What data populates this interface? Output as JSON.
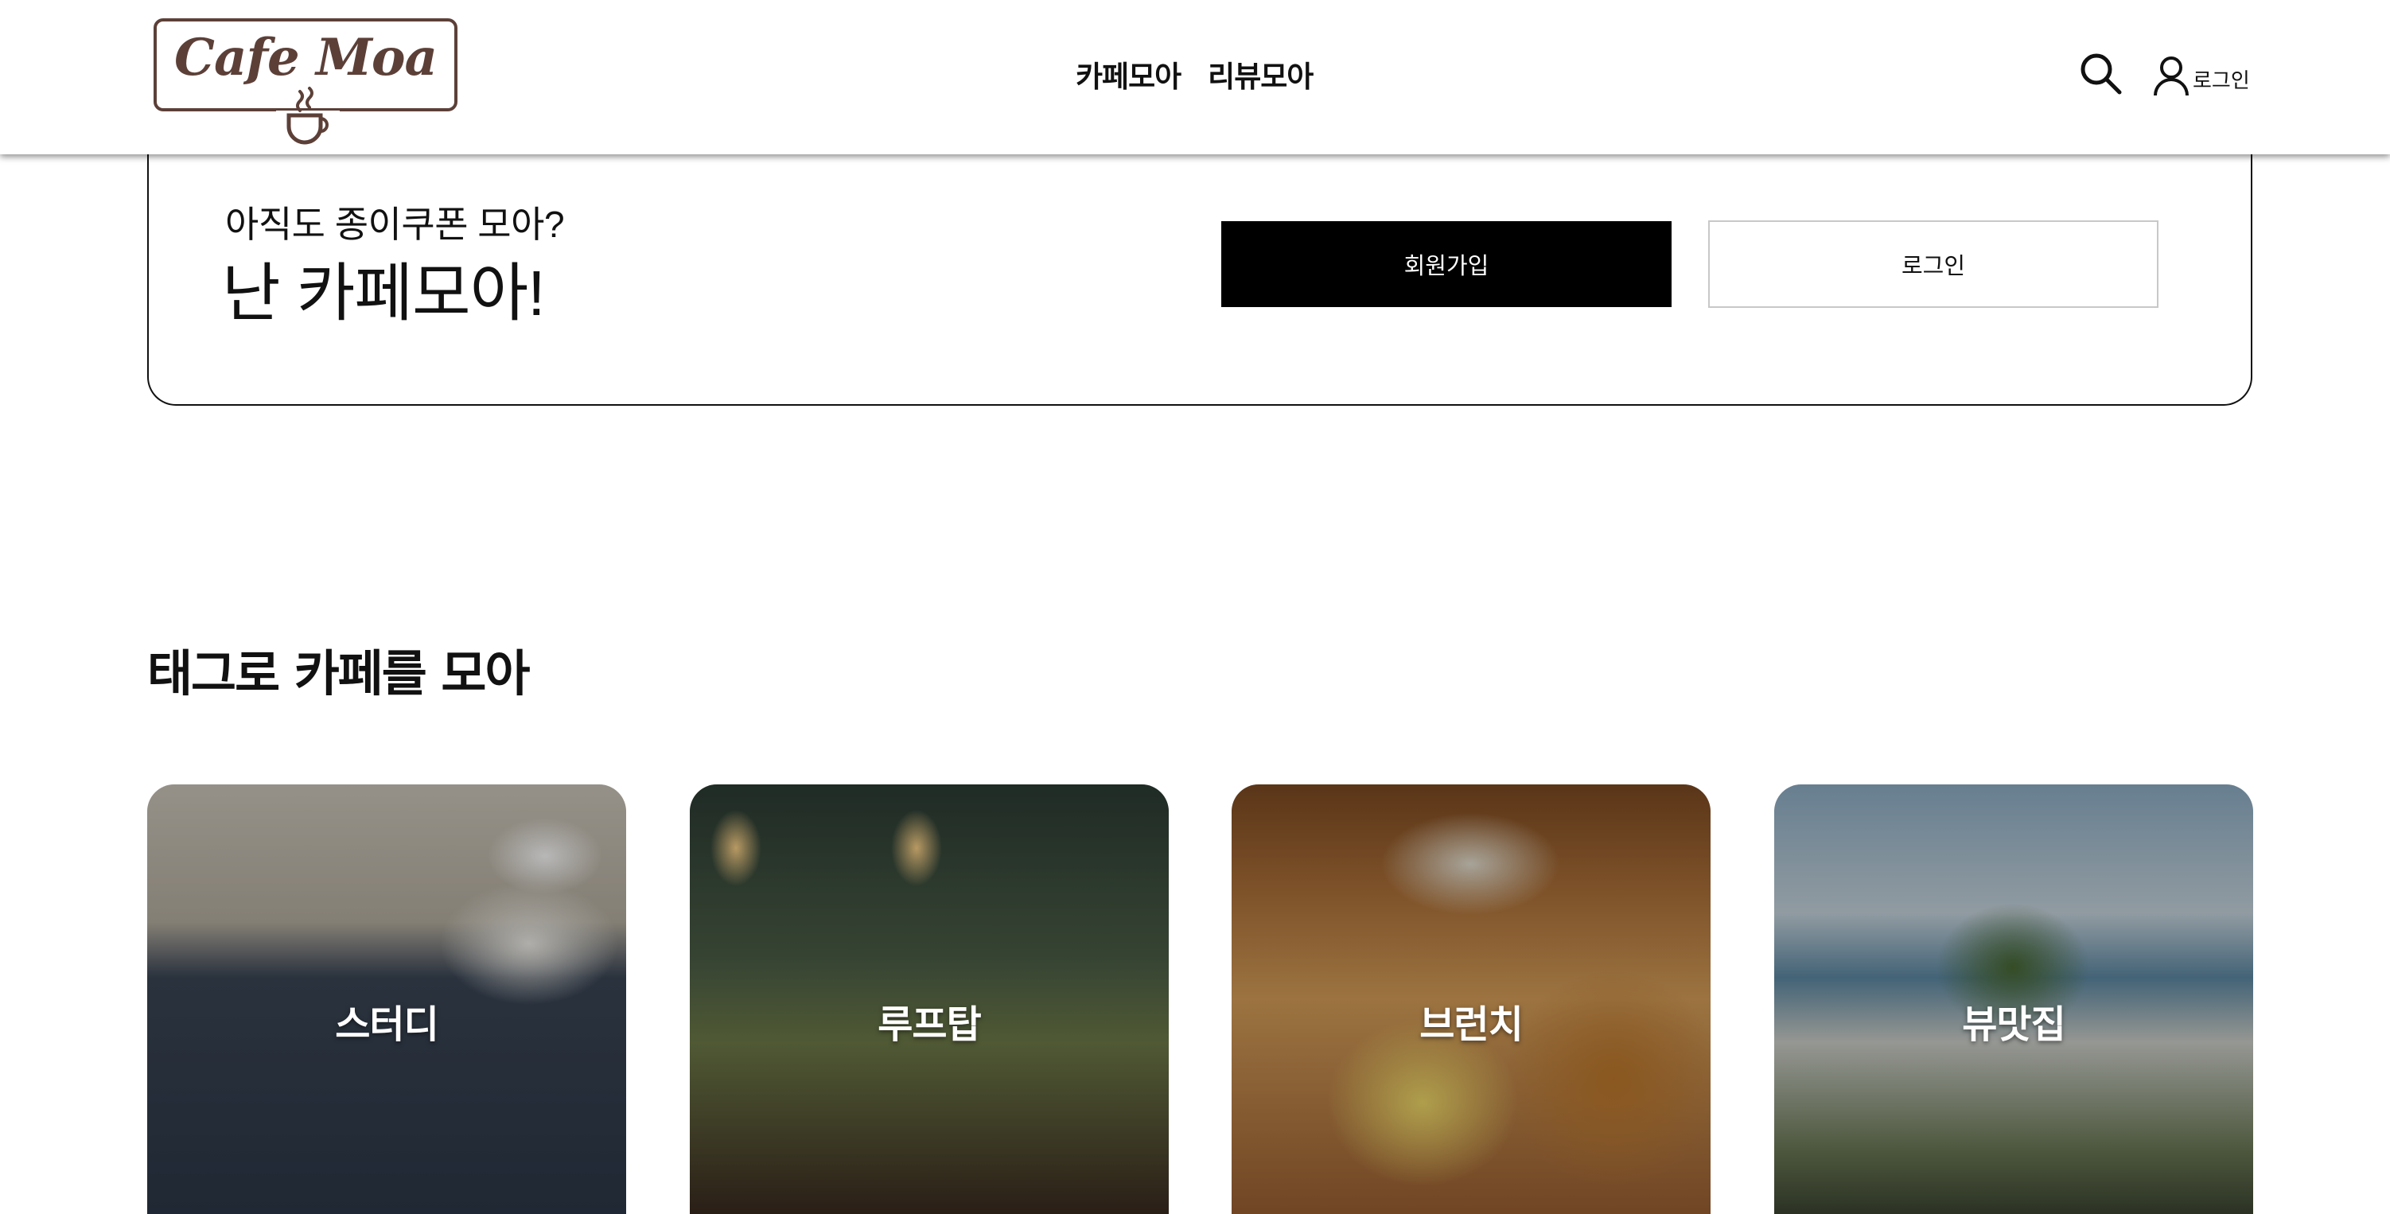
{
  "header": {
    "logo_text": "Cafe Moa",
    "nav": [
      {
        "label": "카페모아"
      },
      {
        "label": "리뷰모아"
      }
    ],
    "login_label": "로그인"
  },
  "promo": {
    "subtitle": "아직도 종이쿠폰 모아?",
    "title": "난 카페모아!",
    "signup_button": "회원가입",
    "login_button": "로그인"
  },
  "tags_section": {
    "title": "태그로 카페를 모아",
    "cards": [
      {
        "label": "스터디"
      },
      {
        "label": "루프탑"
      },
      {
        "label": "브런치"
      },
      {
        "label": "뷰맛집"
      }
    ]
  },
  "colors": {
    "brand": "#5c4038",
    "primary_button": "#000000",
    "text": "#111111"
  }
}
